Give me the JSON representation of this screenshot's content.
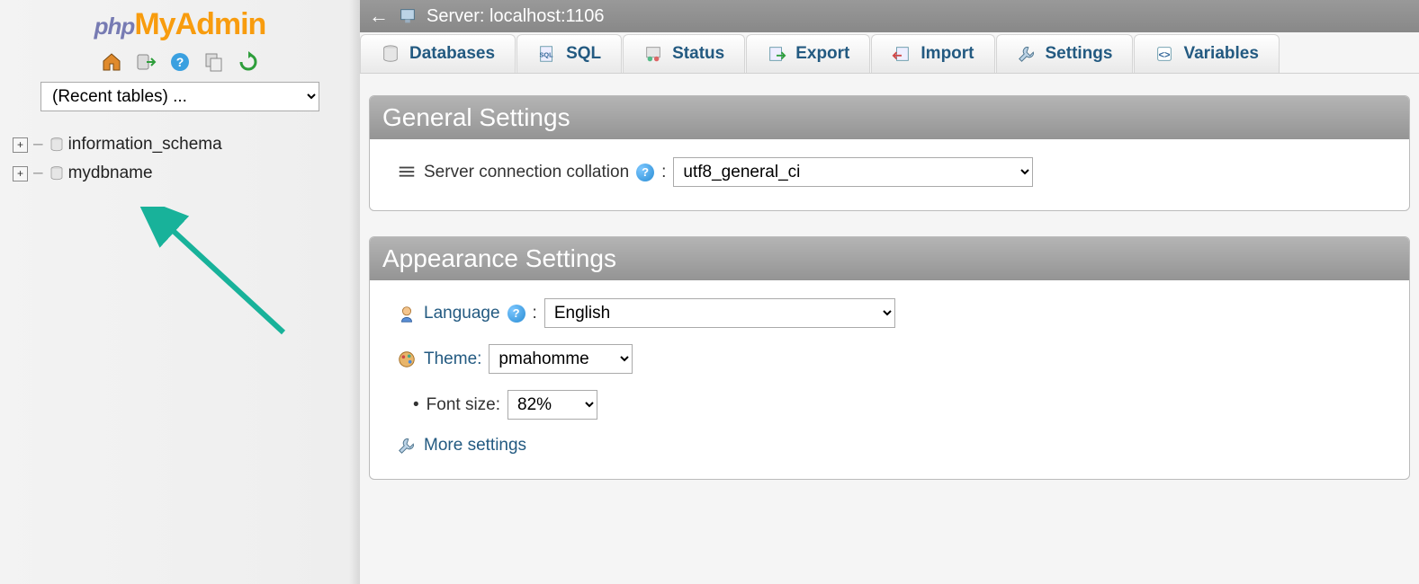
{
  "logo": {
    "php": "php",
    "my": "My",
    "admin": "Admin"
  },
  "sidebar": {
    "recent_tables_placeholder": "(Recent tables) ...",
    "databases": [
      {
        "name": "information_schema"
      },
      {
        "name": "mydbname"
      }
    ]
  },
  "serverbar": {
    "label": "Server: localhost:1106"
  },
  "tabs": [
    {
      "label": "Databases",
      "icon": "databases"
    },
    {
      "label": "SQL",
      "icon": "sql"
    },
    {
      "label": "Status",
      "icon": "status"
    },
    {
      "label": "Export",
      "icon": "export"
    },
    {
      "label": "Import",
      "icon": "import"
    },
    {
      "label": "Settings",
      "icon": "settings"
    },
    {
      "label": "Variables",
      "icon": "variables"
    }
  ],
  "general": {
    "title": "General Settings",
    "collation_label": "Server connection collation",
    "collation_value": "utf8_general_ci"
  },
  "appearance": {
    "title": "Appearance Settings",
    "language_label": "Language",
    "language_value": "English",
    "theme_label": "Theme:",
    "theme_value": "pmahomme",
    "fontsize_label": "Font size:",
    "fontsize_value": "82%",
    "more_settings": "More settings"
  }
}
